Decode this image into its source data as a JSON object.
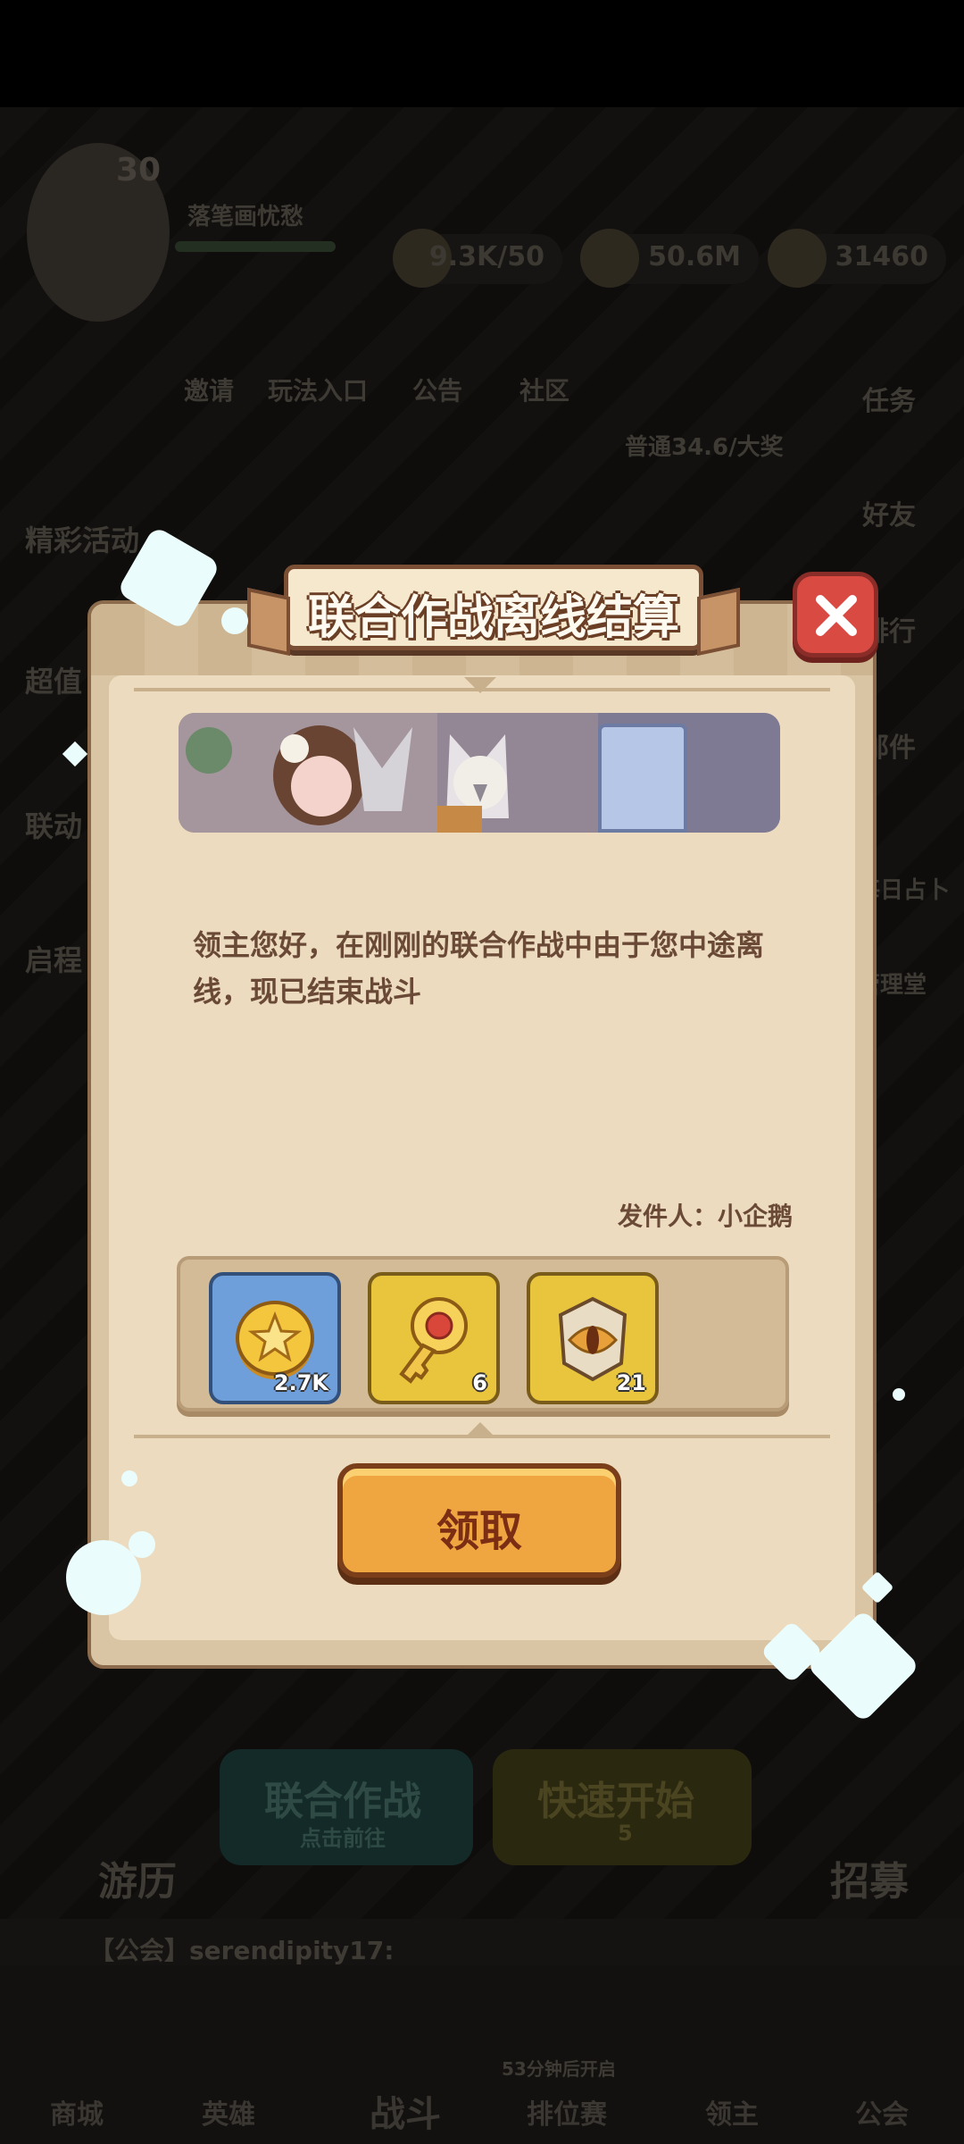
{
  "background": {
    "player_level": "30",
    "player_name": "落笔画忧愁",
    "resources": [
      "9.3K/50",
      "50.6M",
      "31460"
    ],
    "top_menu": [
      "邀请",
      "玩法入口",
      "公告",
      "社区"
    ],
    "right_menu": [
      "任务",
      "好友",
      "排行",
      "邮件",
      "每日占卜",
      "管理堂"
    ],
    "left_menu": [
      "精彩活动",
      "超值",
      "联动",
      "启程"
    ],
    "notice": "普通34.6/大奖",
    "bottom_buttons": {
      "coop": "联合作战",
      "coop_sub": "点击前往",
      "quick": "快速开始",
      "quick_sub": "5",
      "travel": "游历",
      "recruit": "招募"
    },
    "chat": "【公会】serendipity17:",
    "nav": [
      "商城",
      "英雄",
      "战斗",
      "排位赛",
      "领主",
      "公会"
    ],
    "nav_sub": "53分钟后开启"
  },
  "modal": {
    "title": "联合作战离线结算",
    "message": "领主您好，在刚刚的联合作战中由于您中途离线，现已结束战斗",
    "sender": "发件人：小企鹅",
    "rewards": [
      {
        "icon": "gold-coin-icon",
        "quantity": "2.7K",
        "color": "#6f9fda"
      },
      {
        "icon": "golden-key-icon",
        "quantity": "6",
        "color": "#e8c53c"
      },
      {
        "icon": "eye-badge-icon",
        "quantity": "21",
        "color": "#e8c53c"
      }
    ],
    "claim_label": "领取"
  }
}
